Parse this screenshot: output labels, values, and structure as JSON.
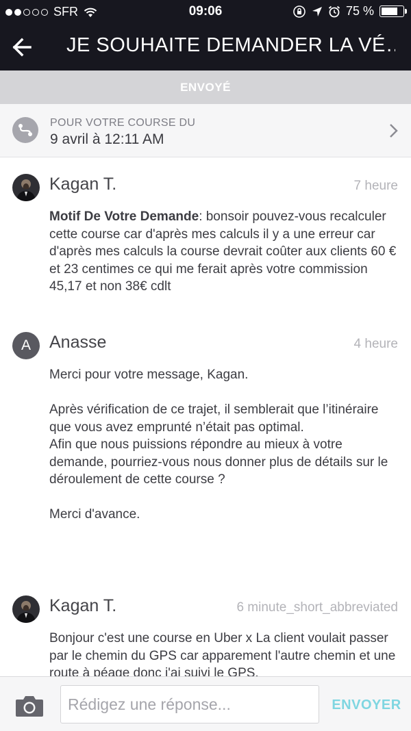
{
  "status_bar": {
    "carrier": "SFR",
    "time": "09:06",
    "battery": "75 %",
    "battery_level": 0.75
  },
  "header": {
    "title": "JE SOUHAITE DEMANDER LA VÉ…"
  },
  "state_band": {
    "label": "ENVOYÉ"
  },
  "trip": {
    "label": "POUR VOTRE COURSE DU",
    "date": "9 avril à 12:11 AM"
  },
  "messages": [
    {
      "author": "Kagan T.",
      "time": "7 heure",
      "label": "Motif De Votre Demande",
      "body": ": bonsoir pouvez-vous recalculer cette course car d'après mes calculs il y a une erreur car d'après mes calculs la course devrait coûter aux clients 60 € et 23 centimes ce qui me ferait après votre commission 45,17 et non 38€ cdlt"
    },
    {
      "author": "Anasse",
      "avatar_letter": "A",
      "time": "4 heure",
      "body": "Merci pour votre message, Kagan.\n\nAprès vérification de ce trajet, il semblerait que l’itinéraire que vous avez emprunté n’était pas optimal.\nAfin que nous puissions répondre au mieux à votre demande, pourriez-vous nous donner plus de détails sur le déroulement de cette course ?\n\nMerci d'avance."
    },
    {
      "author": "Kagan T.",
      "time": "6 minute_short_abbreviated",
      "body": "Bonjour c'est une course en Uber x La client voulait passer par le chemin du GPS car apparement l'autre chemin et une route à péage donc j'ai suivi le GPS."
    }
  ],
  "composer": {
    "placeholder": "Rédigez une réponse...",
    "send_label": "ENVOYER"
  },
  "colors": {
    "header_bg": "#17171f",
    "band_bg": "#d4d4d7",
    "send_accent": "#7fd6e1"
  },
  "icons": [
    "wifi-icon",
    "lock-rotation-icon",
    "location-arrow-icon",
    "alarm-icon",
    "battery-icon",
    "back-arrow-icon",
    "route-icon",
    "chevron-right-icon",
    "camera-icon"
  ]
}
